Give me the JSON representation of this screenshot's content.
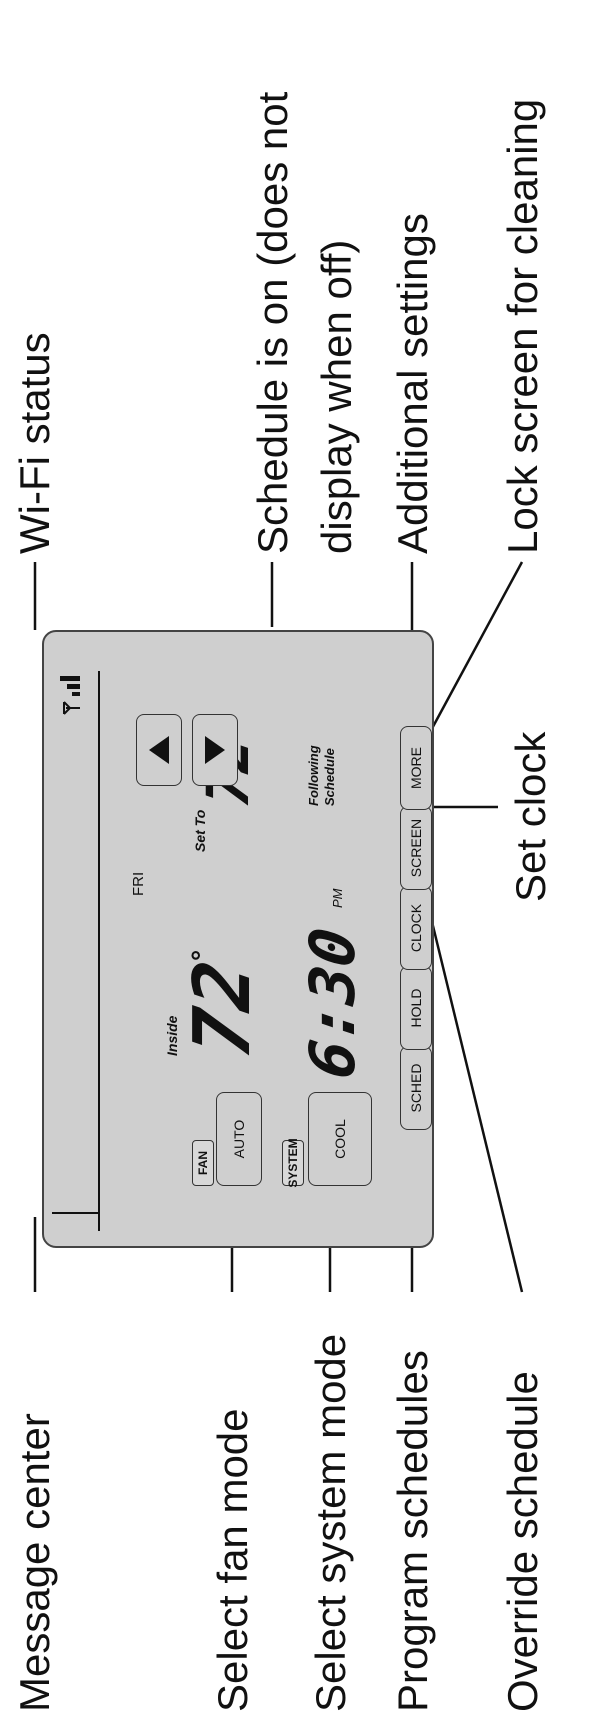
{
  "callouts": {
    "message_center": "Message center",
    "fan_mode": "Select fan mode",
    "system_mode": "Select system mode",
    "program_schedules": "Program schedules",
    "override_schedule": "Override schedule",
    "wifi_status": "Wi-Fi status",
    "schedule_on_line1": "Schedule is on (does not",
    "schedule_on_line2": "display when off)",
    "additional_settings": "Additional settings",
    "lock_screen": "Lock screen for cleaning",
    "set_clock": "Set clock"
  },
  "thermostat": {
    "day": "FRI",
    "inside_label": "Inside",
    "inside_temp": "72",
    "degree": "°",
    "set_to_label": "Set To",
    "set_temp": "72",
    "time": "6:30",
    "ampm": "PM",
    "status_line1": "Following",
    "status_line2": "Schedule",
    "fan_tag": "FAN",
    "fan_value": "AUTO",
    "system_tag": "SYSTEM",
    "system_value": "COOL",
    "buttons": {
      "sched": "SCHED",
      "hold": "HOLD",
      "clock": "CLOCK",
      "screen": "SCREEN",
      "more": "MORE"
    }
  }
}
